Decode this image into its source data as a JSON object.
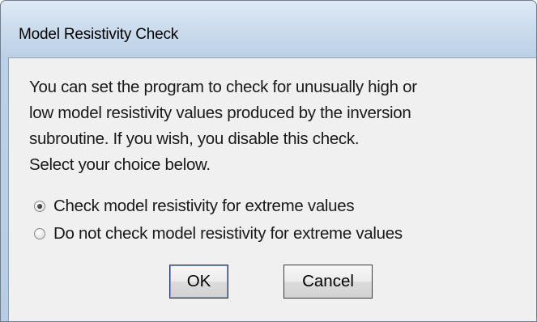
{
  "dialog": {
    "title": "Model Resistivity Check",
    "message_lines": [
      "You can set the program to check for unusually high or",
      "low model resistivity values produced by the inversion",
      "subroutine. If you wish, you disable this check.",
      "Select your choice below."
    ],
    "options": [
      {
        "label": "Check model resistivity for extreme values",
        "selected": true
      },
      {
        "label": "Do not check model resistivity  for extreme values",
        "selected": false
      }
    ],
    "buttons": {
      "ok_label": "OK",
      "cancel_label": "Cancel"
    }
  }
}
